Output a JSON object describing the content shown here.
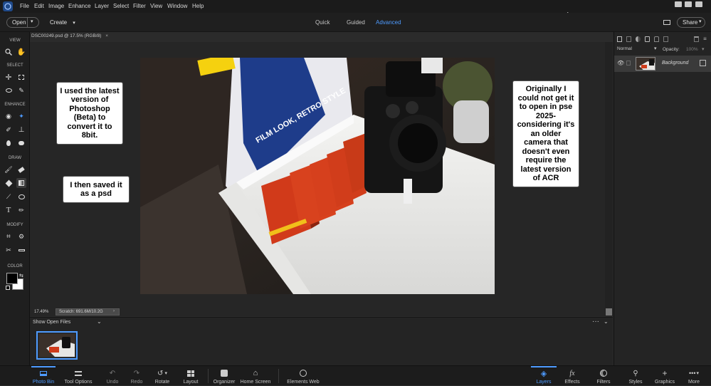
{
  "menu": {
    "items": [
      "File",
      "Edit",
      "Image",
      "Enhance",
      "Layer",
      "Select",
      "Filter",
      "View",
      "Window",
      "Help"
    ]
  },
  "options_bar": {
    "open_label": "Open",
    "create_label": "Create",
    "modes": [
      "Quick",
      "Guided",
      "Advanced"
    ],
    "active_mode": "Advanced",
    "share_label": "Share"
  },
  "toolbar": {
    "sections": [
      "VIEW",
      "SELECT",
      "ENHANCE",
      "DRAW",
      "MODIFY",
      "COLOR"
    ]
  },
  "document": {
    "tab_label": "DSC00249.psd @ 17.5% (RGB/8)",
    "zoom": "17.49%",
    "scratch": "Scratch: 691.6M/10.2G"
  },
  "callouts": {
    "left_top": "I used the latest version of Photoshop (Beta) to convert it to 8bit.",
    "left_bottom": "I then saved it as a psd",
    "right": "Originally I could not get it to open in pse 2025- considering it's an older camera that doesn't even require the latest version of ACR"
  },
  "photo_bin": {
    "dropdown_label": "Show Open Files"
  },
  "layers_panel": {
    "blend_mode": "Normal",
    "opacity_label": "Opacity:",
    "opacity_value": "100%",
    "layer_name": "Background"
  },
  "bottom_bar": {
    "left": [
      {
        "label": "Photo Bin",
        "icon": "photo-bin-icon",
        "active": true
      },
      {
        "label": "Tool Options",
        "icon": "tool-options-icon",
        "active": false
      },
      {
        "label": "Undo",
        "icon": "undo-icon",
        "active": false
      },
      {
        "label": "Redo",
        "icon": "redo-icon",
        "active": false
      },
      {
        "label": "Rotate",
        "icon": "rotate-icon",
        "active": false
      },
      {
        "label": "Layout",
        "icon": "layout-icon",
        "active": false
      },
      {
        "label": "Organizer",
        "icon": "organizer-icon",
        "active": false
      },
      {
        "label": "Home Screen",
        "icon": "home-icon",
        "active": false
      },
      {
        "label": "Elements Web",
        "icon": "globe-icon",
        "active": false
      }
    ],
    "right": [
      {
        "label": "Layers",
        "icon": "layers-icon",
        "active": true
      },
      {
        "label": "Effects",
        "icon": "fx-icon",
        "active": false
      },
      {
        "label": "Filters",
        "icon": "filters-icon",
        "active": false
      },
      {
        "label": "Styles",
        "icon": "styles-icon",
        "active": false
      },
      {
        "label": "Graphics",
        "icon": "plus-icon",
        "active": false
      },
      {
        "label": "More",
        "icon": "more-icon",
        "active": false
      }
    ]
  },
  "colors": {
    "accent": "#4e9bff",
    "panel_bg": "#1f1f1f",
    "canvas_bg": "#262626"
  }
}
